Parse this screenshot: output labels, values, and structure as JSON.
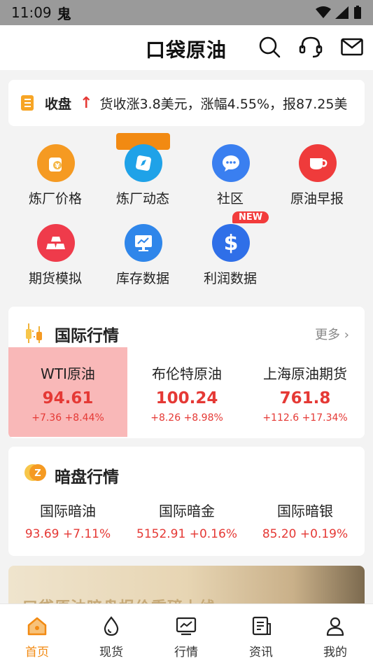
{
  "status_bar": {
    "time": "11:09",
    "app_glyph": "鬼"
  },
  "header": {
    "logo": "口袋原油",
    "search_icon": "search-icon",
    "service_icon": "headset-icon",
    "mail_icon": "mail-icon"
  },
  "ticker": {
    "title": "收盘",
    "text": "货收涨3.8美元，涨幅4.55%，报87.25美"
  },
  "grid": [
    {
      "label": "炼厂价格",
      "color": "#f59a22",
      "icon": "money-bag-icon"
    },
    {
      "label": "炼厂动态",
      "color": "#1fa2e8",
      "icon": "compass-icon"
    },
    {
      "label": "社区",
      "color": "#3a7ff0",
      "icon": "chat-icon"
    },
    {
      "label": "原油早报",
      "color": "#ef3b3b",
      "icon": "cup-icon"
    },
    {
      "label": "期货模拟",
      "color": "#ef3b4b",
      "icon": "gold-bars-icon"
    },
    {
      "label": "库存数据",
      "color": "#2f86ea",
      "icon": "screen-chart-icon"
    },
    {
      "label": "利润数据",
      "color": "#2f6fe8",
      "icon": "dollar-icon"
    }
  ],
  "new_badge": "NEW",
  "intl": {
    "title": "国际行情",
    "more": "更多",
    "quotes": [
      {
        "name": "WTI原油",
        "price": "94.61",
        "change": "+7.36  +8.44%"
      },
      {
        "name": "布伦特原油",
        "price": "100.24",
        "change": "+8.26  +8.98%"
      },
      {
        "name": "上海原油期货",
        "price": "761.8",
        "change": "+112.6  +17.34%"
      }
    ]
  },
  "dark": {
    "title": "暗盘行情",
    "items": [
      {
        "name": "国际暗油",
        "value": "93.69 +7.11%"
      },
      {
        "name": "国际暗金",
        "value": "5152.91 +0.16%"
      },
      {
        "name": "国际暗银",
        "value": "85.20 +0.19%"
      }
    ]
  },
  "banner": {
    "text": "口袋原油暗盘报价重磅上线"
  },
  "tabs": [
    {
      "label": "首页",
      "icon": "home-icon",
      "active": true
    },
    {
      "label": "现货",
      "icon": "drop-icon",
      "active": false
    },
    {
      "label": "行情",
      "icon": "chart-icon",
      "active": false
    },
    {
      "label": "资讯",
      "icon": "news-icon",
      "active": false
    },
    {
      "label": "我的",
      "icon": "user-icon",
      "active": false
    }
  ],
  "colors": {
    "accent": "#f28a12",
    "up": "#e53935",
    "highlight": "#f9b8b8"
  }
}
